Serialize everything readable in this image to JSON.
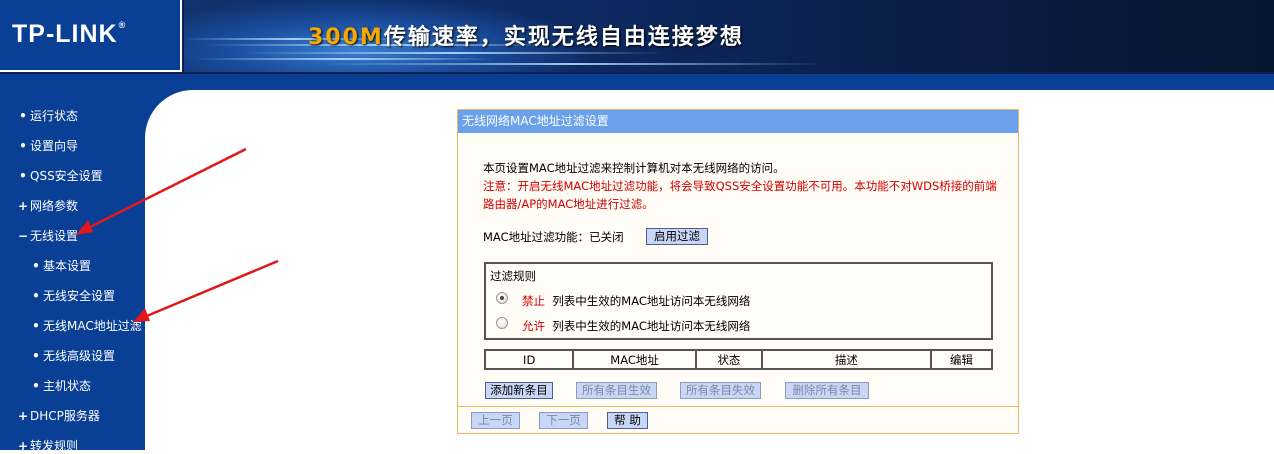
{
  "header": {
    "logo": "TP-LINK",
    "logo_mark": "®",
    "slogan_number": "300M",
    "slogan_text": "传输速率，实现无线自由连接梦想"
  },
  "sidebar": {
    "items": [
      {
        "label": "运行状态",
        "bullet": "•"
      },
      {
        "label": "设置向导",
        "bullet": "•"
      },
      {
        "label": "QSS安全设置",
        "bullet": "•"
      },
      {
        "label": "网络参数",
        "bullet": "+"
      },
      {
        "label": "无线设置",
        "bullet": "−"
      },
      {
        "label": "基本设置",
        "bullet": "•"
      },
      {
        "label": "无线安全设置",
        "bullet": "•"
      },
      {
        "label": "无线MAC地址过滤",
        "bullet": "•"
      },
      {
        "label": "无线高级设置",
        "bullet": "•"
      },
      {
        "label": "主机状态",
        "bullet": "•"
      },
      {
        "label": "DHCP服务器",
        "bullet": "+"
      },
      {
        "label": "转发规则",
        "bullet": "+"
      }
    ]
  },
  "panel": {
    "title": "无线网络MAC地址过滤设置",
    "intro": "本页设置MAC地址过滤来控制计算机对本无线网络的访问。",
    "notice_line1": "注意：开启无线MAC地址过滤功能，将会导致QSS安全设置功能不可用。本功能不对WDS桥接的前端",
    "notice_line2": "路由器/AP的MAC地址进行过滤。",
    "filter_status_label": "MAC地址过滤功能：已关闭",
    "enable_button": "启用过滤",
    "rules": {
      "legend": "过滤规则",
      "options": [
        {
          "keyword": "禁止",
          "text": "列表中生效的MAC地址访问本无线网络",
          "checked": true
        },
        {
          "keyword": "允许",
          "text": "列表中生效的MAC地址访问本无线网络",
          "checked": false
        }
      ]
    },
    "table": {
      "columns": [
        "ID",
        "MAC地址",
        "状态",
        "描述",
        "编辑"
      ]
    },
    "actions": {
      "add": "添加新条目",
      "enable_all": "所有条目生效",
      "disable_all": "所有条目失效",
      "delete_all": "删除所有条目"
    },
    "pager": {
      "prev": "上一页",
      "next": "下一页",
      "help": "帮 助"
    }
  },
  "colors": {
    "nav_blue": "#0a3f96",
    "title_bar": "#6aa1ea",
    "panel_border": "#f2b766",
    "notice_red": "#d40000",
    "arrow_red": "#e01818"
  }
}
